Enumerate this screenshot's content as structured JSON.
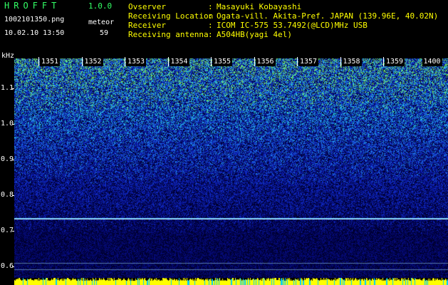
{
  "header": {
    "app_name": "HROFFT",
    "app_version": "1.0.0",
    "file_name": "1002101350.png",
    "datetime": "10.02.10 13:50",
    "meteor_label": "meteor",
    "meteor_count": "59"
  },
  "info": [
    {
      "label": "Ovserver",
      "value": "Masayuki Kobayashi"
    },
    {
      "label": "Receiving Location",
      "value": "Ogata-vill. Akita-Pref. JAPAN (139.96E, 40.02N)"
    },
    {
      "label": "Receiver",
      "value": "ICOM IC-575 53.7492(@LCD)MHz USB"
    },
    {
      "label": "Receiving antenna",
      "value": "A504HB(yagi 4el)"
    }
  ],
  "separator": ":",
  "spectrogram": {
    "y_unit_label": "kHz",
    "y_ticks": [
      "1.1",
      "1.0",
      "0.9",
      "0.8",
      "0.7",
      "0.6"
    ],
    "x_ticks": [
      "1351",
      "1352",
      "1353",
      "1354",
      "1355",
      "1356",
      "1357",
      "1358",
      "1359",
      "1400"
    ],
    "colors": {
      "background": "#000000",
      "header_text": "#ffff00",
      "title": "#33ff66",
      "bottom_bar": "#ffff00",
      "signal_line": "#88ccff"
    }
  }
}
